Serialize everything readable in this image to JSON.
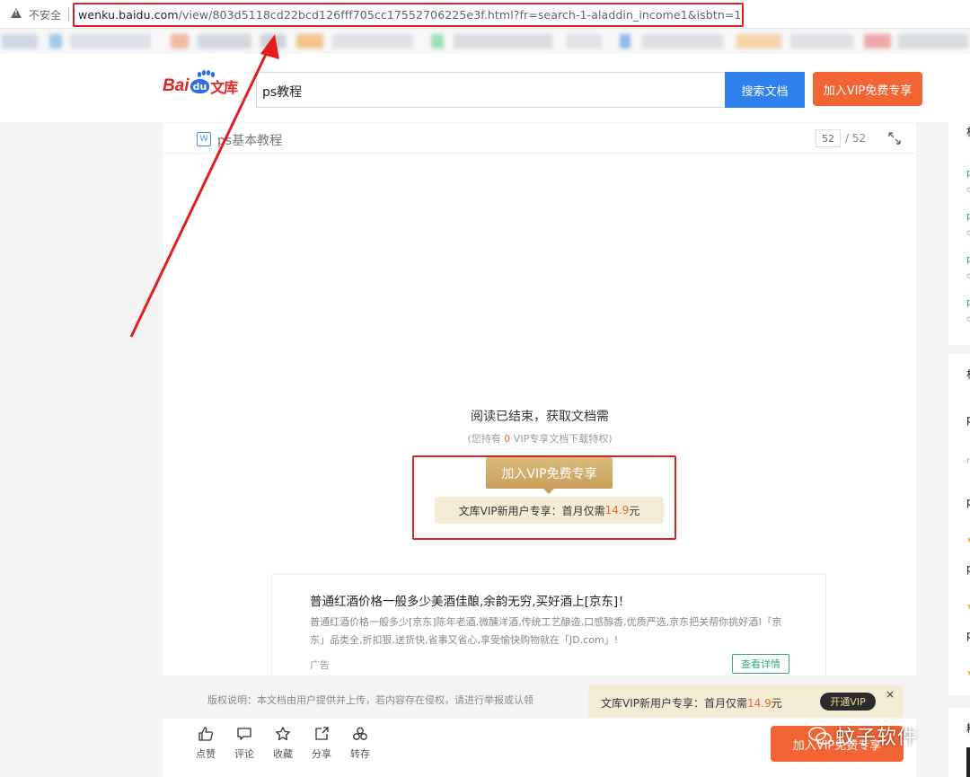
{
  "browser": {
    "insecure_label": "不安全",
    "url_host": "wenku.baidu.com",
    "url_path": "/view/803d5118cd22bcd126fff705cc17552706225e3f.html?fr=search-1-aladdin_income1&isbtn=1"
  },
  "header": {
    "logo_bai": "Bai",
    "logo_du": "du",
    "logo_wenku": "文库",
    "search_value": "ps教程",
    "search_button": "搜索文档",
    "vip_button": "加入VIP免费专享"
  },
  "doc": {
    "type_icon": "W",
    "title": "ps基本教程",
    "page_current": "52",
    "page_total": "/ 52",
    "end_title": "阅读已结束，获取文档需",
    "end_sub_prefix": "(您持有 ",
    "end_sub_count": "0",
    "end_sub_suffix": " VIP专享文档下载特权)",
    "join_vip_button": "加入VIP免费专享",
    "promo_prefix": "文库VIP新用户专享：首月仅需",
    "promo_price": "14.9",
    "promo_unit": "元"
  },
  "ad": {
    "title": "普通红酒价格一般多少美酒佳酿,余韵无穷,买好酒上[京东]！",
    "desc": "普通红酒价格一般多少[京东]陈年老酒,微醺洋酒,传统工艺酿造,口感醇香,优质严选,京东把关帮你挑好酒!「京东」品类全,折扣狠,送货快,省事又省心,享受愉快购物就在「JD.com」!",
    "tag": "广告",
    "detail_button": "查看详情"
  },
  "footer": {
    "copyright": "版权说明：本文档由用户提供并上传，若内容存在侵权，请进行举报或认领",
    "vip_bar_prefix": "文库VIP新用户专享：首月仅需",
    "vip_bar_price": "14.9",
    "vip_bar_unit": "元",
    "vip_bar_button": "开通VIP",
    "vip_bar_close": "×",
    "bottom_vip_button": "加入VIP免费专享",
    "watermark": "蚊子软件"
  },
  "toolbar": {
    "items": [
      {
        "label": "点赞",
        "icon": "thumbs-up-icon"
      },
      {
        "label": "评论",
        "icon": "comment-icon"
      },
      {
        "label": "收藏",
        "icon": "star-icon"
      },
      {
        "label": "分享",
        "icon": "share-icon"
      },
      {
        "label": "转存",
        "icon": "save-to-icon"
      }
    ]
  },
  "sidebar": {
    "card1_heading": "相",
    "card1_items": [
      "p",
      "p",
      "p",
      "p"
    ],
    "card2_heading": "相",
    "card2_items": [
      "p",
      "p",
      "p",
      "p",
      "p"
    ],
    "card3_heading": "精"
  },
  "colors": {
    "accent_orange": "#f26434",
    "search_blue": "#2f80ed",
    "gold": "#c89f5a",
    "annotation_red": "#e02020"
  }
}
